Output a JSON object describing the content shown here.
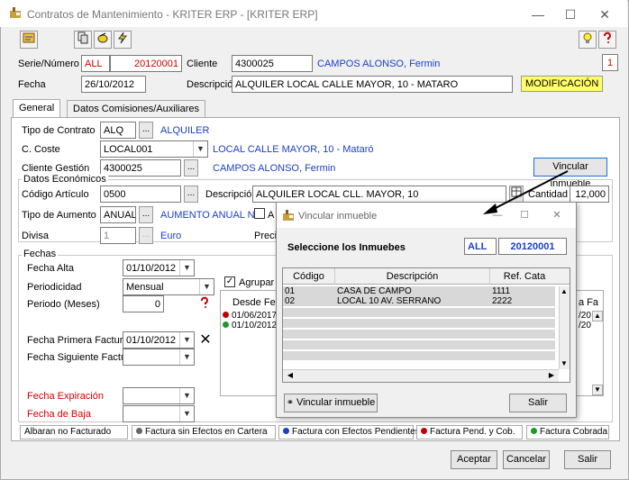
{
  "window": {
    "title": "Contratos de Mantenimiento - KRITER ERP - [KRITER ERP]",
    "minimize": "—",
    "maximize": "☐",
    "close": "✕"
  },
  "counter": "1",
  "header": {
    "serie_label": "Serie/Número",
    "serie_value": "ALL",
    "numero_value": "20120001",
    "cliente_label": "Cliente",
    "cliente_code": "4300025",
    "cliente_name": "CAMPOS ALONSO, Fermin",
    "fecha_label": "Fecha",
    "fecha_value": "26/10/2012",
    "descripcion_label": "Descripción",
    "descripcion_value": "ALQUILER LOCAL CALLE MAYOR, 10 - MATARO",
    "status_badge": "MODIFICACIÓN"
  },
  "tabs": [
    {
      "label": "General"
    },
    {
      "label": "Datos Comisiones/Auxiliares"
    }
  ],
  "general": {
    "tipo_contrato_label": "Tipo de Contrato",
    "tipo_contrato_code": "ALQ",
    "tipo_contrato_name": "ALQUILER",
    "coste_label": "C. Coste",
    "coste_code": "LOCAL001",
    "coste_name": "LOCAL CALLE MAYOR, 10 - Mataró",
    "cliente_gestion_label": "Cliente Gestión",
    "cliente_gestion_code": "4300025",
    "cliente_gestion_name": "CAMPOS ALONSO, Fermin",
    "vincular_button": "Vincular inmueble",
    "datos_economicos_label": "Datos Económicos",
    "codigo_articulo_label": "Código Artículo",
    "codigo_articulo_value": "0500",
    "art_descripcion_label": "Descripción",
    "art_descripcion_value": "ALQUILER LOCAL CLL. MAYOR, 10",
    "cantidad_label": "Cantidad",
    "cantidad_value": "12,000",
    "tipo_aumento_label": "Tipo de Aumento",
    "tipo_aumento_code": "ANUAL",
    "tipo_aumento_name": "AUMENTO ANUAL NO",
    "tipo_aumento_check": "A",
    "divisa_label": "Divisa",
    "divisa_code": "1",
    "divisa_name": "Euro",
    "precio_label": "Precio"
  },
  "fechas": {
    "group_label": "Fechas",
    "fecha_alta_label": "Fecha Alta",
    "fecha_alta_value": "01/10/2012",
    "periodicidad_label": "Periodicidad",
    "periodicidad_value": "Mensual",
    "periodo_label": "Periodo (Meses)",
    "periodo_value": "0",
    "primera_factura_label": "Fecha Primera Factura",
    "primera_factura_value": "01/10/2012",
    "siguiente_factura_label": "Fecha Siguiente Factura",
    "expiracion_label": "Fecha Expiración",
    "baja_label": "Fecha de Baja",
    "agrupar_label": "Agrupar e",
    "desde_fecha_header": "Desde Fech",
    "rows": [
      "01/06/2017",
      "01/10/2012"
    ],
    "right_header": "a Fa",
    "right_rows": [
      "/20",
      "/20"
    ]
  },
  "legend": {
    "albaran": "Albaran no Facturado",
    "sin_efectos": "Factura sin Efectos en Cartera",
    "efectos_pendientes": "Factura con Efectos Pendientes",
    "pend_cob": "Factura Pend. y Cob.",
    "cobrada": "Factura Cobrada"
  },
  "buttons": {
    "aceptar": "Aceptar",
    "cancelar": "Cancelar",
    "salir": "Salir"
  },
  "dialog": {
    "title": "Vincular inmueble",
    "heading": "Seleccione los Inmuebes",
    "serie": "ALL",
    "numero": "20120001",
    "columns": [
      "Código",
      "Descripción",
      "Ref. Cata"
    ],
    "rows": [
      {
        "codigo": "01",
        "descripcion": "CASA DE CAMPO",
        "ref": "1111"
      },
      {
        "codigo": "02",
        "descripcion": "LOCAL 10 AV. SERRANO",
        "ref": "2222"
      }
    ],
    "vincular_button": "Vincular inmueble",
    "salir_button": "Salir"
  },
  "colors": {
    "accent_blue": "#1a3fc8",
    "required_red": "#d40000",
    "badge_yellow": "#ffff66"
  }
}
